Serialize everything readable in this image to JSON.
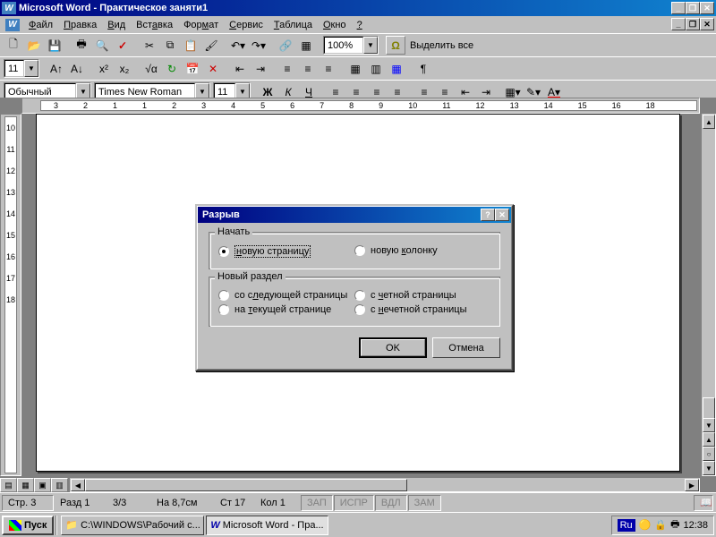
{
  "app": {
    "title": "Microsoft Word - Практическое заняти1"
  },
  "menu": {
    "file": "Файл",
    "edit": "Правка",
    "view": "Вид",
    "insert": "Вставка",
    "format": "Формат",
    "tools": "Сервис",
    "table": "Таблица",
    "window": "Окно",
    "help": "?"
  },
  "toolbar": {
    "zoom": "100%",
    "select_all": "Выделить все",
    "style": "Обычный",
    "font": "Times New Roman",
    "size": "11"
  },
  "ruler_h": [
    "3",
    "2",
    "1",
    "1",
    "2",
    "3",
    "4",
    "5",
    "6",
    "7",
    "8",
    "9",
    "10",
    "11",
    "12",
    "13",
    "14",
    "15",
    "16",
    "18"
  ],
  "ruler_v": [
    "10",
    "11",
    "12",
    "13",
    "14",
    "15",
    "16",
    "17",
    "18"
  ],
  "dialog": {
    "title": "Разрыв",
    "group1_title": "Начать",
    "opt_newpage": "новую страницу",
    "opt_newcol": "новую колонку",
    "group2_title": "Новый раздел",
    "opt_nextpage": "со следующей страницы",
    "opt_even": "с четной страницы",
    "opt_current": "на текущей странице",
    "opt_odd": "с нечетной страницы",
    "ok": "OK",
    "cancel": "Отмена"
  },
  "status": {
    "page": "Стр. 3",
    "section": "Разд 1",
    "pages": "3/3",
    "at": "На 8,7см",
    "line": "Ст 17",
    "col": "Кол 1",
    "rec": "ЗАП",
    "trk": "ИСПР",
    "ext": "ВДЛ",
    "ovr": "ЗАМ"
  },
  "taskbar": {
    "start": "Пуск",
    "task1": "C:\\WINDOWS\\Рабочий с...",
    "task2": "Microsoft Word - Пра...",
    "lang": "Ru",
    "time": "12:38"
  }
}
